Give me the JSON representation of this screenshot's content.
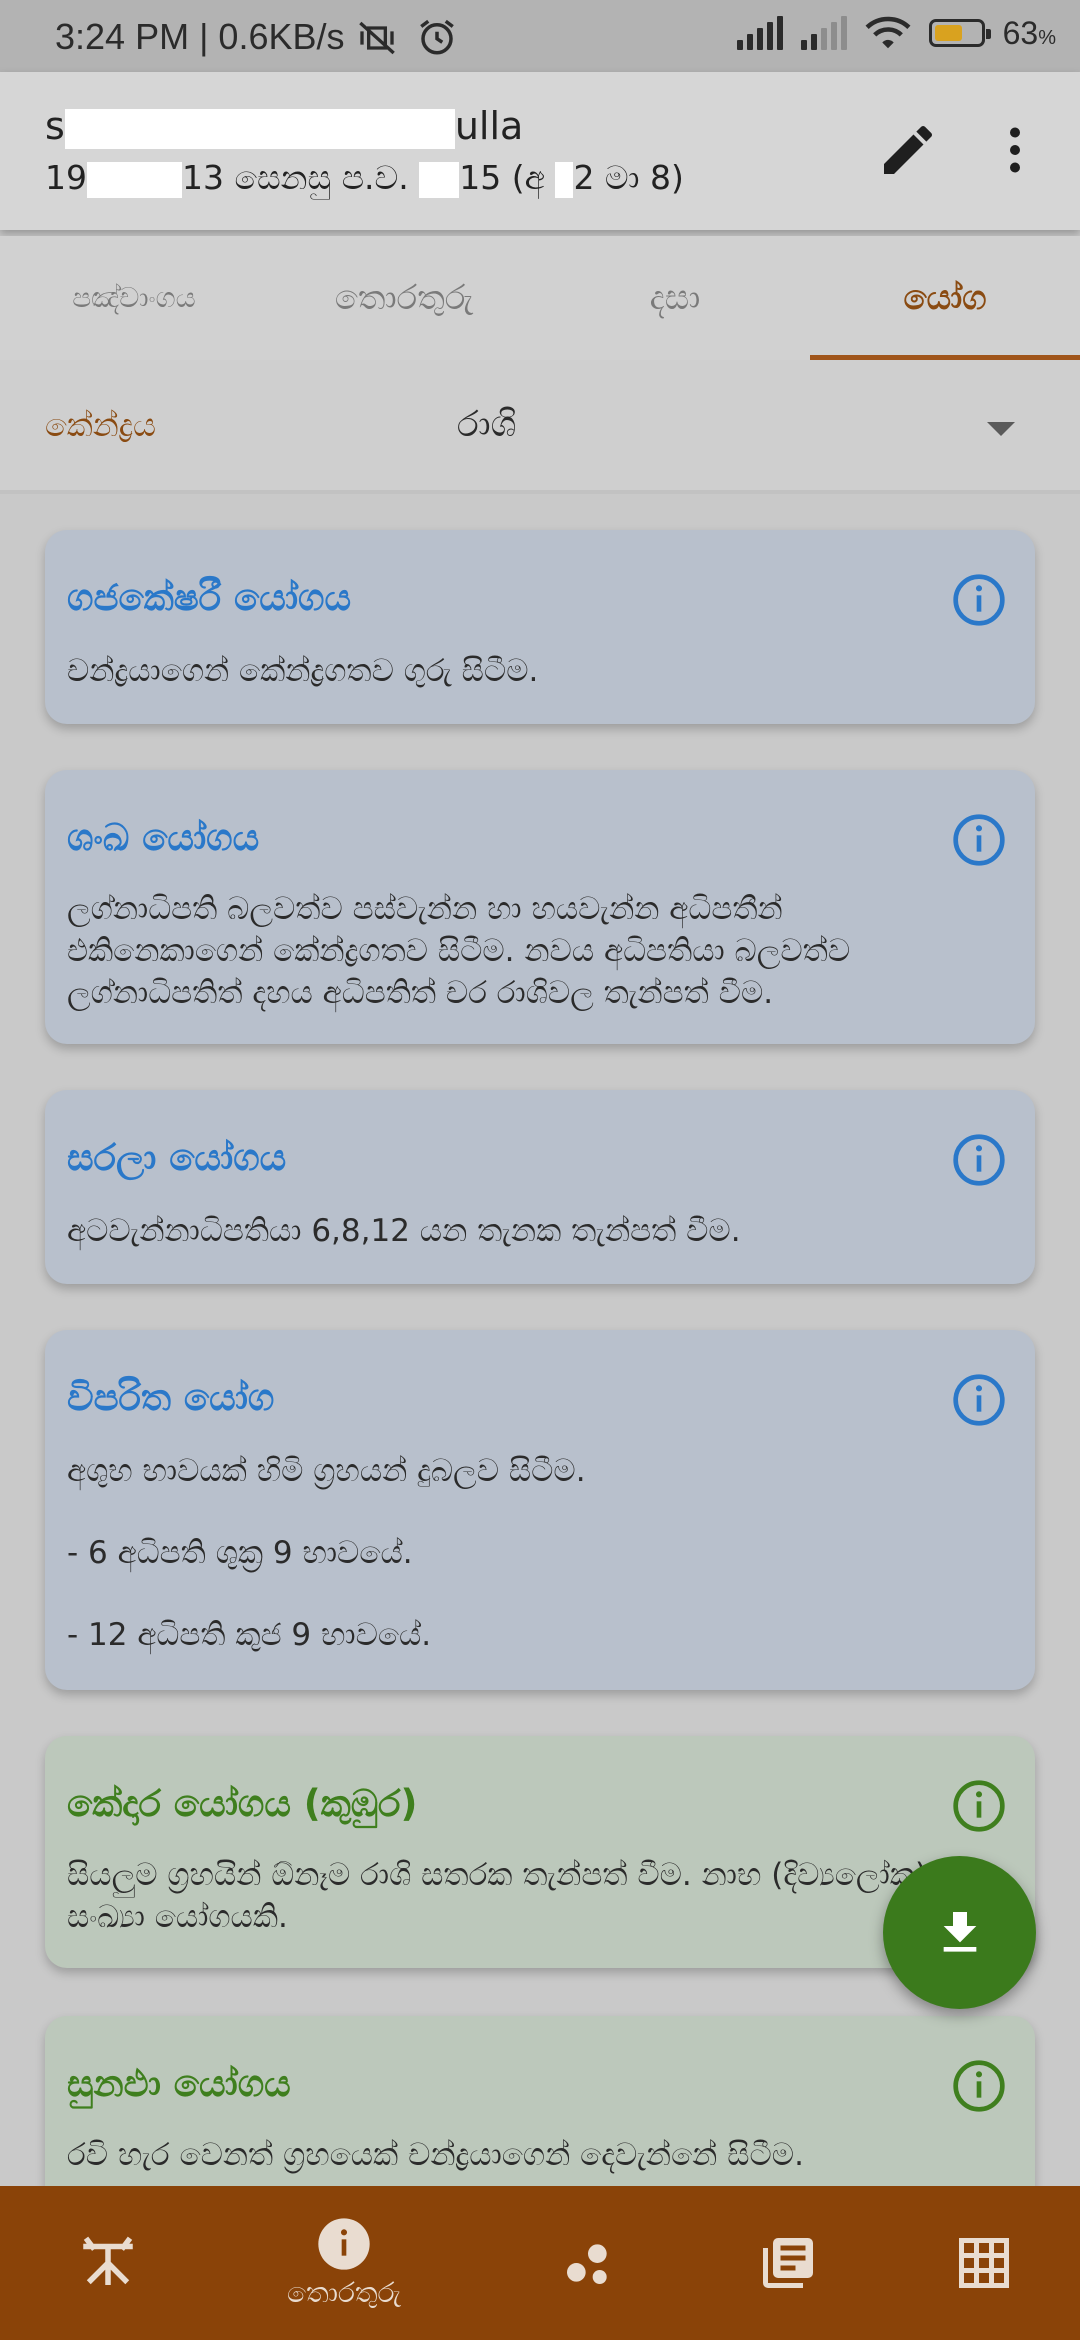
{
  "status_bar": {
    "time": "3:24 PM | 0.6KB/s",
    "battery_percent": "63",
    "battery_unit": "%",
    "battery_level": 0.63,
    "icons": [
      "mute-vibrate-icon",
      "alarm-icon",
      "signal-icon",
      "signal-weak-icon",
      "wifi-icon",
      "battery-icon"
    ]
  },
  "header": {
    "name_start": "s",
    "name_end": "ulla",
    "sub_part1": "19",
    "sub_part2": "13 සෙනසු ප.ව.",
    "sub_part3": "15 (අ",
    "sub_part4": "2 මා 8)",
    "actions": [
      "edit-icon",
      "more-vert-icon"
    ]
  },
  "tabs": [
    {
      "label": "පඤ්චාංගය",
      "active": false
    },
    {
      "label": "තොරතුරු",
      "active": false
    },
    {
      "label": "දසා",
      "active": false
    },
    {
      "label": "යෝග",
      "active": true
    }
  ],
  "selector": {
    "label": "කේන්ද්‍රය",
    "value": "රාශි"
  },
  "yogas": [
    {
      "title": "ගජකේෂරී යෝගය",
      "lines": [
        "චන්ද්‍රයාගෙන් කේන්ද්‍රගතව ගුරු සිටීම."
      ],
      "color": "blue"
    },
    {
      "title": "ශංඛ යෝගය",
      "lines": [
        "ලග්නාධිපති බලවත්ව පස්වැන්න හා හයවැන්න අධිපතීන් එකිනෙකාගෙන් කේන්ද්‍රගතව සිටීම. නවය අධිපතියා බලවත්ව ලග්නාධිපතිත් දහය අධිපතිත් චර රාශිවල තැන්පත් වීම."
      ],
      "color": "blue"
    },
    {
      "title": "සරලා යෝගය",
      "lines": [
        "අටවැන්නාධිපතියා 6,8,12 යන තැනක තැන්පත් වීම."
      ],
      "color": "blue"
    },
    {
      "title": "විපරිත යෝග",
      "lines": [
        "අශුභ භාවයක් හිමි ග්‍රහයන් දුබලව සිටීම.",
        "- 6 අධිපති ශුක්‍ර 9 භාවයේ.",
        "- 12 අධිපති කුජ 9 භාවයේ."
      ],
      "color": "blue"
    },
    {
      "title": "කේදාර යෝගය (කුඹුර)",
      "lines": [
        "සියලුම ග්‍රහයින් ඕනෑම රාශි සතරක තැන්පත් වීම. නාභ (දිව්‍යලෝක) - සංඛ්‍යා යෝගයකි."
      ],
      "color": "green"
    },
    {
      "title": "සුනඵා යෝගය",
      "lines": [
        "රවි හැර වෙනත් ග්‍රහයෙක් චන්ද්‍රයාගෙන් දෙවැන්නේ සිටීම."
      ],
      "color": "green"
    }
  ],
  "fab": {
    "icon": "download-icon"
  },
  "bottom_nav": [
    {
      "icon": "chart-star-icon",
      "label": ""
    },
    {
      "icon": "info-icon",
      "label": "තොරතුරු"
    },
    {
      "icon": "planets-icon",
      "label": ""
    },
    {
      "icon": "library-books-icon",
      "label": ""
    },
    {
      "icon": "grid-icon",
      "label": ""
    }
  ],
  "colors": {
    "accent": "#8a4b12",
    "card_blue": "#b8c0cc",
    "card_green": "#bcc8bb",
    "title_blue": "#2a78c9",
    "title_green": "#3f7f1e",
    "nav_bg": "#8a4308",
    "fab_bg": "#3b7a1c"
  }
}
